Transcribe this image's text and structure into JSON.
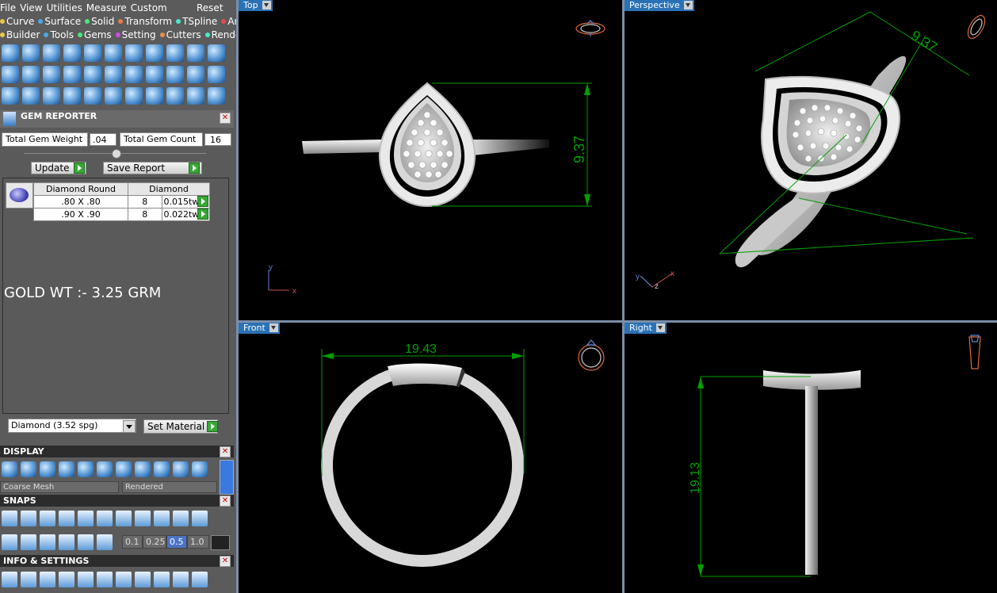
{
  "menu": {
    "items": [
      "File",
      "View",
      "Utilities",
      "Measure",
      "Custom"
    ],
    "reset": "Reset"
  },
  "toolbar_row1": [
    {
      "label": "Curve",
      "color": "#e8c84a"
    },
    {
      "label": "Surface",
      "color": "#4aa8e8"
    },
    {
      "label": "Solid",
      "color": "#4ae87a"
    },
    {
      "label": "Transform",
      "color": "#e87a4a"
    },
    {
      "label": "TSpline",
      "color": "#4ae8d0"
    },
    {
      "label": "Art",
      "color": "#e84a4a"
    }
  ],
  "toolbar_row2": [
    {
      "label": "Builder",
      "color": "#e8c84a"
    },
    {
      "label": "Tools",
      "color": "#4aa8e8"
    },
    {
      "label": "Gems",
      "color": "#4ae87a"
    },
    {
      "label": "Setting",
      "color": "#d04ae8"
    },
    {
      "label": "Cutters",
      "color": "#e8904a"
    },
    {
      "label": "Render",
      "color": "#4ae8d0"
    }
  ],
  "gem_reporter": {
    "title": "GEM REPORTER",
    "total_weight_label": "Total Gem Weight",
    "total_weight_value": ".04",
    "total_count_label": "Total Gem Count",
    "total_count_value": "16",
    "update_label": "Update",
    "save_label": "Save Report",
    "columns": [
      "Diamond Round",
      "Diamond"
    ],
    "rows": [
      {
        "size": ".80 X .80",
        "count": "8",
        "weight": "0.015tw"
      },
      {
        "size": ".90 X .90",
        "count": "8",
        "weight": "0.022tw"
      }
    ],
    "note": "GOLD WT :- 3.25 GRM",
    "material_select": "Diamond     (3.52 spg)",
    "set_material_label": "Set Material"
  },
  "display": {
    "title": "DISPLAY",
    "mesh_select": "Coarse Mesh",
    "render_select": "Rendered"
  },
  "snaps": {
    "title": "SNAPS",
    "values": [
      "0.1",
      "0.25",
      "0.5",
      "1.0"
    ],
    "active_value": "0.5"
  },
  "info": {
    "title": "INFO & SETTINGS"
  },
  "viewports": {
    "top": {
      "label": "Top",
      "dim": "9.37"
    },
    "perspective": {
      "label": "Perspective",
      "dim": "9.37"
    },
    "front": {
      "label": "Front",
      "dim": "19.43"
    },
    "right": {
      "label": "Right",
      "dim": "19.13"
    }
  },
  "colors": {
    "dim": "#00a000",
    "tab": "#2a72b5",
    "gizmo": "#e06a3a"
  }
}
